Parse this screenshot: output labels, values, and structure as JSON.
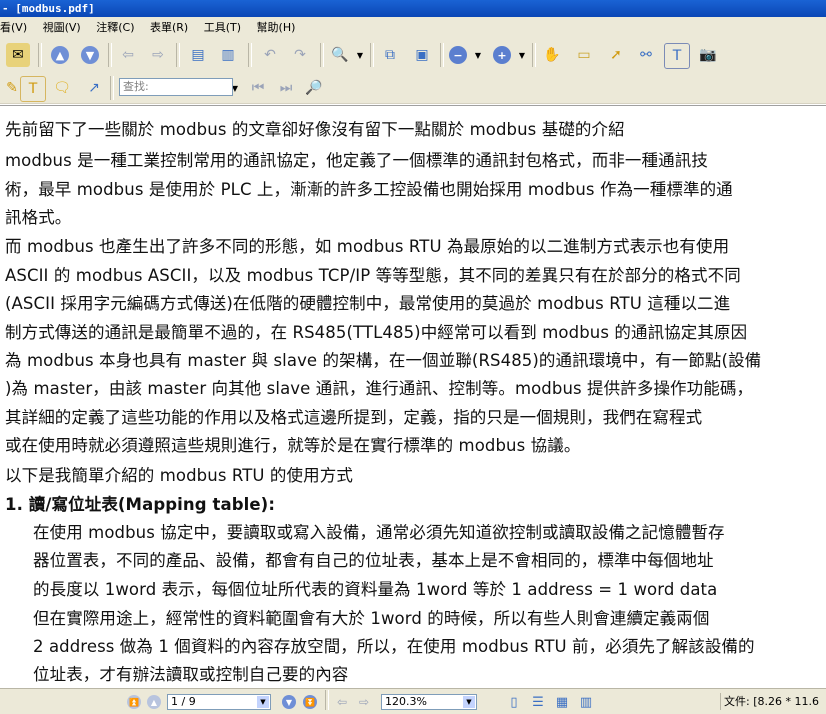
{
  "window": {
    "title": "- [modbus.pdf]"
  },
  "menu": [
    "看(V)",
    "視圖(V)",
    "注釋(C)",
    "表單(R)",
    "工具(T)",
    "幫助(H)"
  ],
  "search": {
    "placeholder": "查找:"
  },
  "content": {
    "lines": [
      "先前留下了一些關於 modbus 的文章卻好像沒有留下一點關於 modbus 基礎的介紹",
      "modbus 是一種工業控制常用的通訊協定，他定義了一個標準的通訊封包格式，而非一種通訊技",
      "術，最早 modbus 是使用於 PLC 上，漸漸的許多工控設備也開始採用 modbus 作為一種標準的通",
      "訊格式。",
      "而 modbus 也產生出了許多不同的形態，如 modbus RTU 為最原始的以二進制方式表示也有使用",
      "ASCII 的 modbus ASCII，以及 modbus TCP/IP 等等型態，其不同的差異只有在於部分的格式不同",
      "(ASCII 採用字元編碼方式傳送)在低階的硬體控制中，最常使用的莫過於 modbus RTU 這種以二進",
      "制方式傳送的通訊是最簡單不過的，在 RS485(TTL485)中經常可以看到 modbus 的通訊協定其原因",
      "為 modbus 本身也具有 master 與 slave 的架構，在一個並聯(RS485)的通訊環境中，有一節點(設備",
      ")為 master，由該 master 向其他 slave 通訊，進行通訊、控制等。modbus 提供許多操作功能碼，",
      "其詳細的定義了這些功能的作用以及格式這邊所提到，定義，指的只是一個規則，我們在寫程式",
      "或在使用時就必須遵照這些規則進行，就等於是在實行標準的 modbus 協議。",
      "以下是我簡單介紹的 modbus RTU 的使用方式"
    ],
    "heading": "1.  讀/寫位址表(Mapping table):",
    "indented_lines": [
      "在使用 modbus 協定中，要讀取或寫入設備，通常必須先知道欲控制或讀取設備之記憶體暫存",
      "器位置表，不同的產品、設備，都會有自己的位址表，基本上是不會相同的，標準中每個地址",
      "的長度以 1word 表示，每個位址所代表的資料量為 1word 等於  1 address = 1 word data",
      "但在實際用途上，經常性的資料範圍會有大於 1word 的時候，所以有些人則會連續定義兩個",
      "2 address 做為 1 個資料的內容存放空間，所以，在使用 modbus RTU 前，必須先了解該設備的",
      "位址表，才有辦法讀取或控制自己要的內容"
    ]
  },
  "status": {
    "page": "1 / 9",
    "zoom": "120.3%",
    "doc_info": "文件: [8.26 * 11.6"
  }
}
